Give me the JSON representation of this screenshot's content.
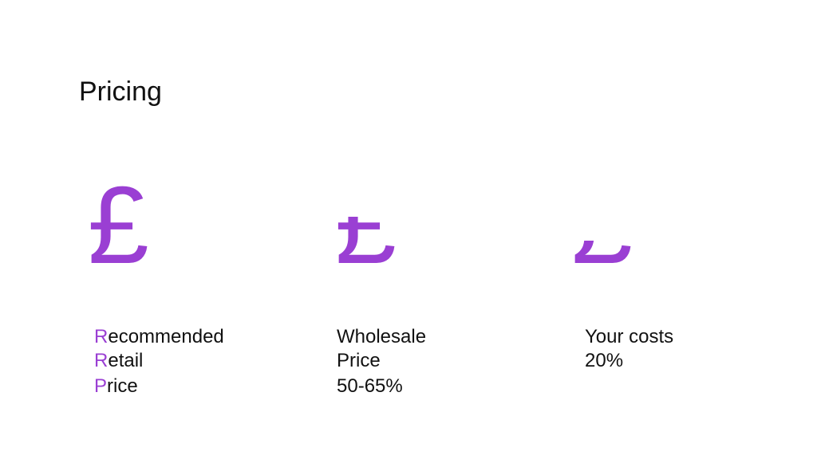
{
  "slide": {
    "title": "Pricing"
  },
  "colors": {
    "accent": "#9a3fd3",
    "text": "#111111",
    "background": "#ffffff"
  },
  "columns": [
    {
      "symbol": "£",
      "symbol_icon": "pound-sign-icon",
      "lines": [
        {
          "initial": "R",
          "rest": "ecommended"
        },
        {
          "initial": "R",
          "rest": "etail"
        },
        {
          "initial": "P",
          "rest": "rice"
        }
      ]
    },
    {
      "symbol": "£",
      "symbol_icon": "pound-sign-partial-icon",
      "lines": [
        "Wholesale",
        "Price",
        "50-65%"
      ]
    },
    {
      "symbol": "£",
      "symbol_icon": "pound-sign-fragment-icon",
      "lines": [
        "Your costs",
        "20%"
      ]
    }
  ]
}
